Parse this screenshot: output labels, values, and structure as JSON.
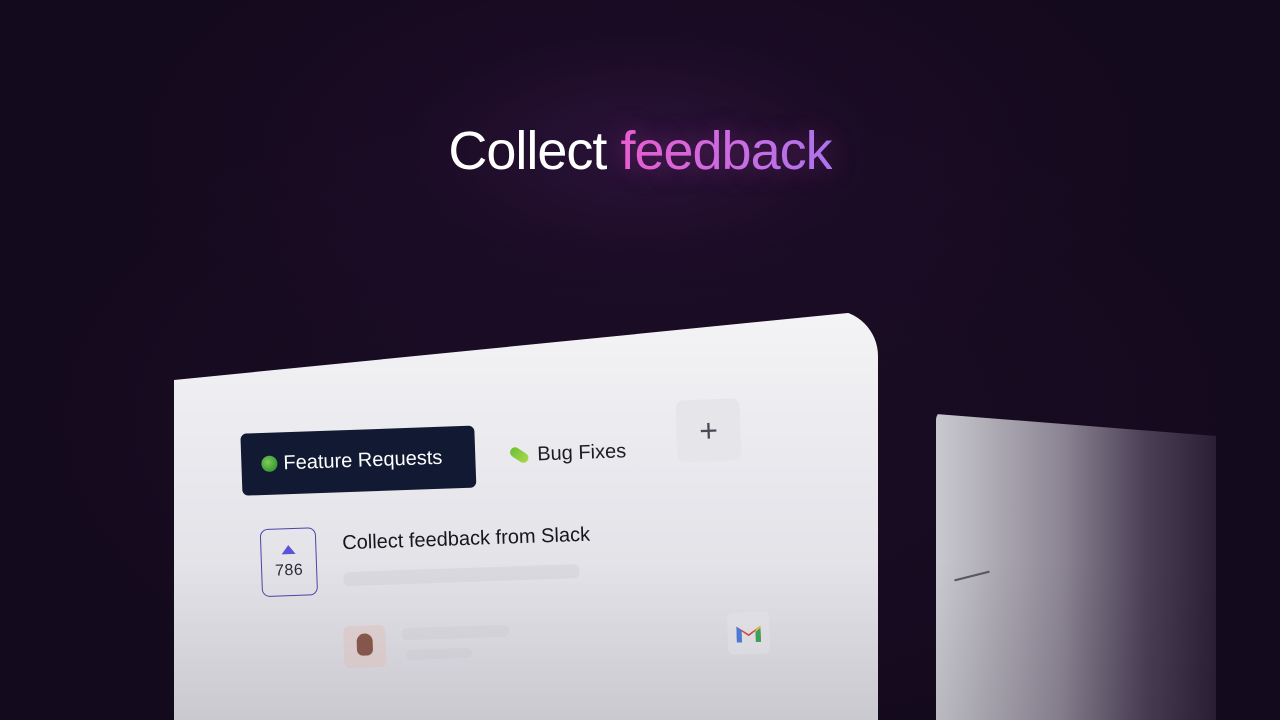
{
  "headline": {
    "part1": "Collect",
    "part2": "feedback"
  },
  "board": {
    "tabs": [
      {
        "label": "Feature Requests",
        "icon": "leaf-icon",
        "active": true
      },
      {
        "label": "Bug Fixes",
        "icon": "bug-icon",
        "active": false
      }
    ],
    "add_tab_label": "+",
    "post": {
      "title": "Collect feedback from Slack",
      "votes": "786",
      "source_icon": "gmail-icon"
    }
  },
  "colors": {
    "background": "#140a1d",
    "accent_pink": "#ea5fd1",
    "accent_purple": "#a877f0",
    "tab_active_bg": "#121a33",
    "vote_border": "#4a46a8"
  }
}
